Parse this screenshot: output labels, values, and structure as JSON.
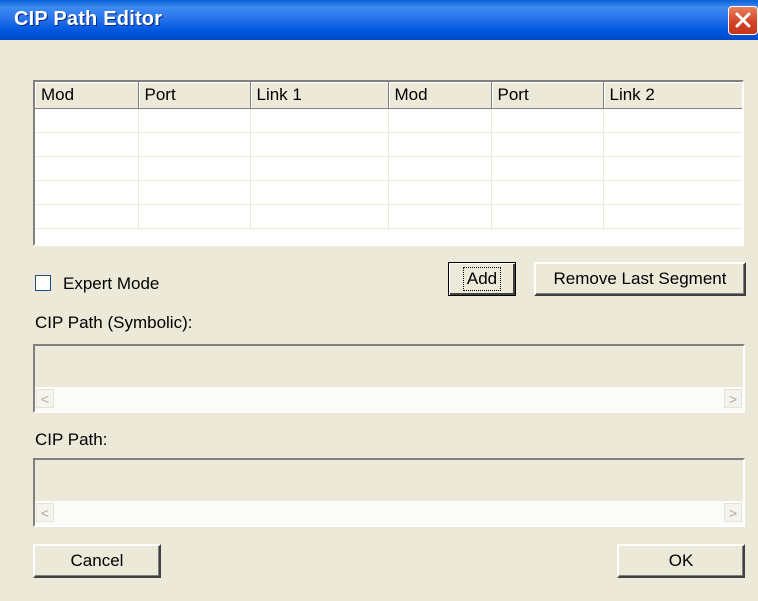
{
  "window": {
    "title": "CIP Path Editor"
  },
  "grid": {
    "columns": [
      "Mod",
      "Port",
      "Link 1",
      "Mod",
      "Port",
      "Link 2"
    ],
    "rows": [
      [
        "",
        "",
        "",
        "",
        "",
        ""
      ],
      [
        "",
        "",
        "",
        "",
        "",
        ""
      ],
      [
        "",
        "",
        "",
        "",
        "",
        ""
      ],
      [
        "",
        "",
        "",
        "",
        "",
        ""
      ],
      [
        "",
        "",
        "",
        "",
        "",
        ""
      ]
    ]
  },
  "expert_mode": {
    "label": "Expert Mode",
    "checked": false
  },
  "buttons": {
    "add": "Add",
    "remove_last": "Remove Last Segment",
    "cancel": "Cancel",
    "ok": "OK"
  },
  "symbolic": {
    "label": "CIP Path (Symbolic):",
    "value": ""
  },
  "path": {
    "label": "CIP Path:",
    "value": ""
  },
  "scroll_icons": {
    "left": "chevron-left-icon",
    "right": "chevron-right-icon"
  }
}
